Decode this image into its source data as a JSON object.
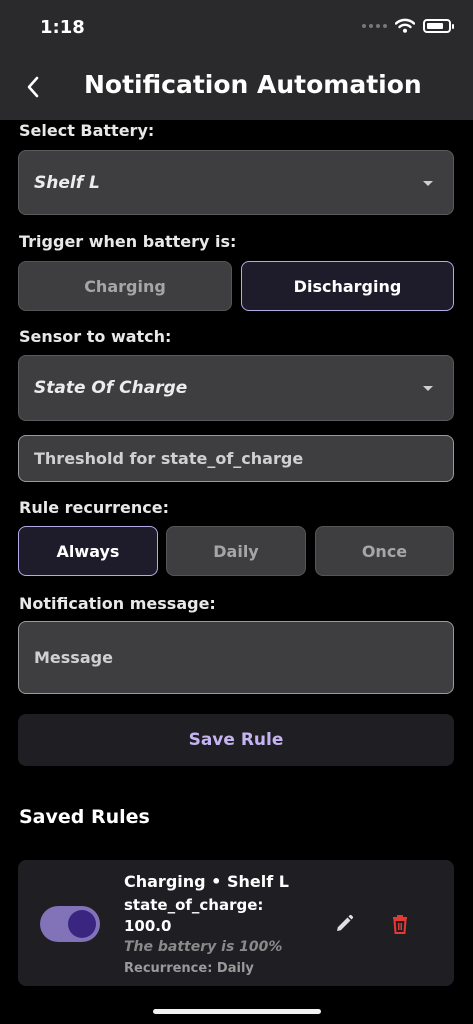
{
  "status_bar": {
    "time": "1:18"
  },
  "nav": {
    "title": "Notification Automation",
    "back_icon": "chevron-left-icon"
  },
  "form": {
    "battery_label": "Select Battery:",
    "battery_value": "Shelf L",
    "trigger_label": "Trigger when battery is:",
    "trigger_options": [
      "Charging",
      "Discharging"
    ],
    "trigger_selected": "Discharging",
    "sensor_label": "Sensor to watch:",
    "sensor_value": "State Of Charge",
    "threshold_placeholder": "Threshold for state_of_charge",
    "recurrence_label": "Rule recurrence:",
    "recurrence_options": [
      "Always",
      "Daily",
      "Once"
    ],
    "recurrence_selected": "Always",
    "message_label": "Notification message:",
    "message_placeholder": "Message",
    "save_label": "Save Rule"
  },
  "saved_rules": {
    "title": "Saved Rules",
    "items": [
      {
        "title": "Charging • Shelf L",
        "sensor": "state_of_charge: 100.0",
        "message": "The battery is 100%",
        "recurrence": "Recurrence: Daily",
        "enabled": true
      }
    ]
  },
  "colors": {
    "accent": "#b7a8e6",
    "save_text": "#c6b4f2",
    "toggle_track": "#8272b8",
    "toggle_knob": "#3a2680",
    "delete": "#e53935"
  }
}
